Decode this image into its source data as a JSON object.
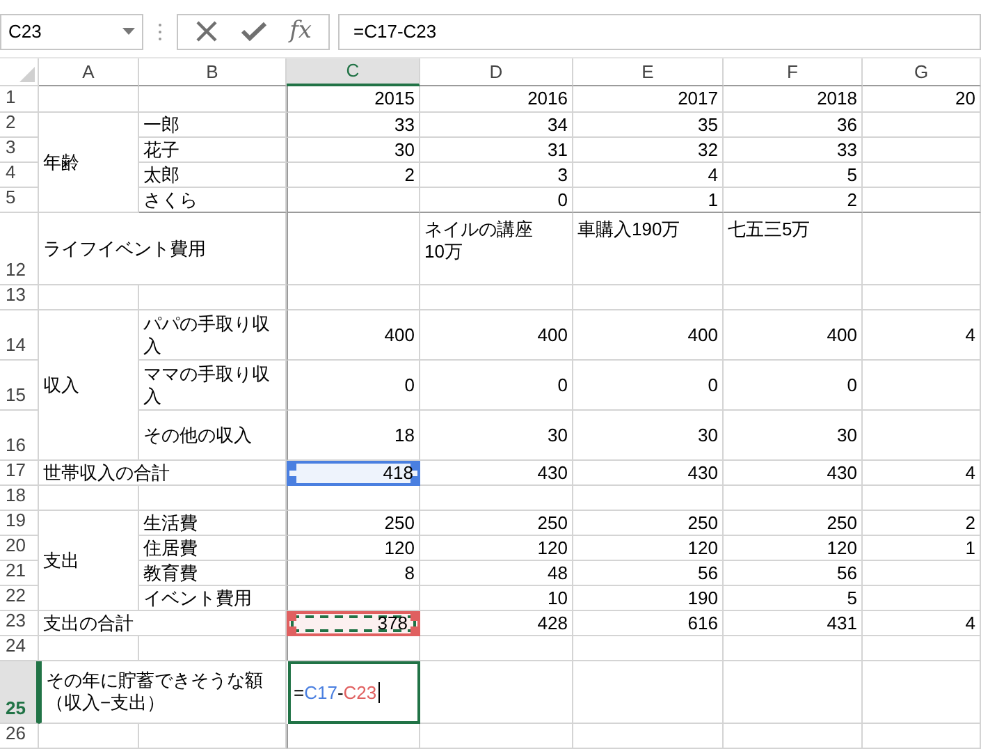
{
  "formula_bar": {
    "name_box": "C23",
    "function_button": "fx",
    "formula": "=C17-C23"
  },
  "columns": [
    {
      "label": "A",
      "selected": false
    },
    {
      "label": "B",
      "selected": false
    },
    {
      "label": "C",
      "selected": true
    },
    {
      "label": "D",
      "selected": false
    },
    {
      "label": "E",
      "selected": false
    },
    {
      "label": "F",
      "selected": false
    },
    {
      "label": "G",
      "selected": false
    }
  ],
  "rows": [
    {
      "number": "1",
      "selected": false,
      "cells": [
        null,
        null,
        {
          "text": "2015"
        },
        {
          "text": "2016"
        },
        {
          "text": "2017"
        },
        {
          "text": "2018"
        },
        {
          "text": "20"
        }
      ]
    },
    {
      "number": "2",
      "selected": false,
      "cells": [
        {
          "text": "年齢"
        },
        {
          "text": "一郎"
        },
        {
          "text": "33"
        },
        {
          "text": "34"
        },
        {
          "text": "35"
        },
        {
          "text": "36"
        },
        null
      ]
    },
    {
      "number": "3",
      "selected": false,
      "cells": [
        null,
        {
          "text": "花子"
        },
        {
          "text": "30"
        },
        {
          "text": "31"
        },
        {
          "text": "32"
        },
        {
          "text": "33"
        },
        null
      ]
    },
    {
      "number": "4",
      "selected": false,
      "cells": [
        null,
        {
          "text": "太郎"
        },
        {
          "text": "2"
        },
        {
          "text": "3"
        },
        {
          "text": "4"
        },
        {
          "text": "5"
        },
        null
      ]
    },
    {
      "number": "5",
      "selected": false,
      "cells": [
        null,
        {
          "text": "さくら"
        },
        null,
        {
          "text": "0"
        },
        {
          "text": "1"
        },
        {
          "text": "2"
        },
        null
      ]
    },
    {
      "number": "12",
      "selected": false,
      "kind": "labels",
      "cells": [
        {
          "text": "ライフイベント費用"
        },
        null,
        null,
        {
          "text": "ネイルの講座10万"
        },
        {
          "text": "車購入190万"
        },
        {
          "text": "七五三5万"
        },
        null
      ]
    },
    {
      "number": "13",
      "selected": false,
      "cells": [
        null,
        null,
        null,
        null,
        null,
        null,
        null
      ]
    },
    {
      "number": "14",
      "selected": false,
      "cells": [
        {
          "text": "収入"
        },
        {
          "text": "パパの手取り収入"
        },
        {
          "text": "400"
        },
        {
          "text": "400"
        },
        {
          "text": "400"
        },
        {
          "text": "400"
        },
        {
          "text": "4"
        }
      ]
    },
    {
      "number": "15",
      "selected": false,
      "cells": [
        null,
        {
          "text": "ママの手取り収入"
        },
        {
          "text": "0"
        },
        {
          "text": "0"
        },
        {
          "text": "0"
        },
        {
          "text": "0"
        },
        null
      ]
    },
    {
      "number": "16",
      "selected": false,
      "cells": [
        null,
        {
          "text": "その他の収入"
        },
        {
          "text": "18"
        },
        {
          "text": "30"
        },
        {
          "text": "30"
        },
        {
          "text": "30"
        },
        null
      ]
    },
    {
      "number": "17",
      "selected": false,
      "cells": [
        {
          "text": "世帯収入の合計"
        },
        null,
        {
          "text": "418",
          "color": "#4a7fe0"
        },
        {
          "text": "430"
        },
        {
          "text": "430"
        },
        {
          "text": "430"
        },
        {
          "text": "4"
        }
      ]
    },
    {
      "number": "18",
      "selected": false,
      "cells": [
        null,
        null,
        null,
        null,
        null,
        null,
        null
      ]
    },
    {
      "number": "19",
      "selected": false,
      "cells": [
        {
          "text": "支出"
        },
        {
          "text": "生活費"
        },
        {
          "text": "250"
        },
        {
          "text": "250"
        },
        {
          "text": "250"
        },
        {
          "text": "250"
        },
        {
          "text": "2"
        }
      ]
    },
    {
      "number": "20",
      "selected": false,
      "cells": [
        null,
        {
          "text": "住居費"
        },
        {
          "text": "120"
        },
        {
          "text": "120"
        },
        {
          "text": "120"
        },
        {
          "text": "120"
        },
        {
          "text": "1"
        }
      ]
    },
    {
      "number": "21",
      "selected": false,
      "cells": [
        null,
        {
          "text": "教育費"
        },
        {
          "text": "8"
        },
        {
          "text": "48"
        },
        {
          "text": "56"
        },
        {
          "text": "56"
        },
        null
      ]
    },
    {
      "number": "22",
      "selected": false,
      "cells": [
        null,
        {
          "text": "イベント費用"
        },
        null,
        {
          "text": "10"
        },
        {
          "text": "190"
        },
        {
          "text": "5"
        },
        null
      ]
    },
    {
      "number": "23",
      "selected": false,
      "cells": [
        {
          "text": "支出の合計"
        },
        null,
        {
          "text": "378",
          "color": "#e06060",
          "marquee": true
        },
        {
          "text": "428"
        },
        {
          "text": "616"
        },
        {
          "text": "431"
        },
        {
          "text": "4"
        }
      ]
    },
    {
      "number": "24",
      "selected": false,
      "cells": [
        null,
        null,
        null,
        null,
        null,
        null,
        null
      ]
    },
    {
      "number": "25",
      "selected": true,
      "cells": [
        {
          "text": "その年に貯蓄できそうな額（収入−支出）"
        },
        null,
        {
          "editing": true,
          "parts": [
            {
              "text": "=",
              "color": "#000000"
            },
            {
              "text": "C17",
              "color": "#4a7fe0"
            },
            {
              "text": "-",
              "color": "#000000"
            },
            {
              "text": "C23",
              "color": "#e06060"
            }
          ]
        },
        null,
        null,
        null,
        null
      ]
    },
    {
      "number": "26",
      "selected": false,
      "cells": [
        null,
        null,
        null,
        null,
        null,
        null,
        null
      ]
    }
  ]
}
